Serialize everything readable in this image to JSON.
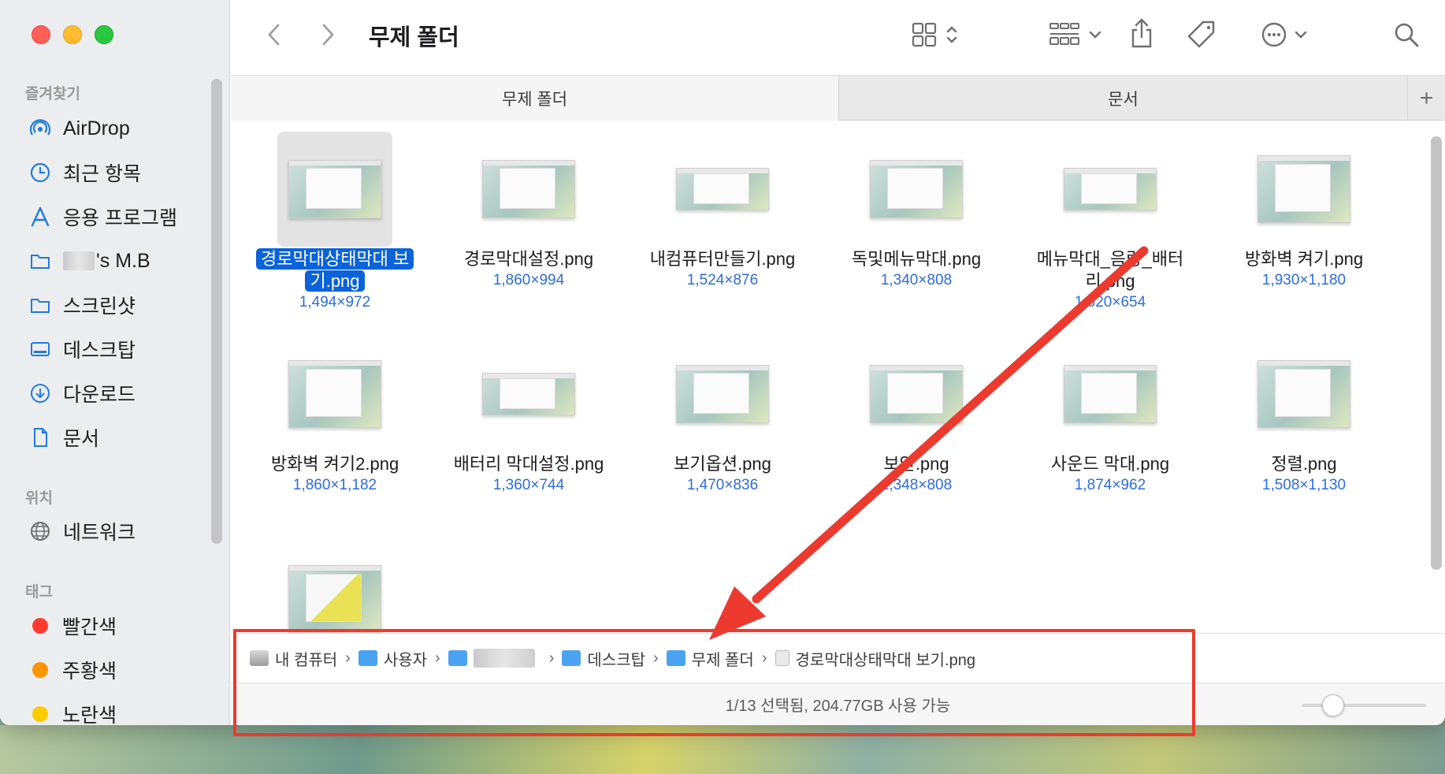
{
  "window": {
    "title": "무제 폴더"
  },
  "sidebar": {
    "favorites_header": "즐겨찾기",
    "favorites": [
      {
        "label": "AirDrop",
        "icon": "airdrop-icon"
      },
      {
        "label": "최근 항목",
        "icon": "clock-icon"
      },
      {
        "label": "응용 프로그램",
        "icon": "applications-icon"
      },
      {
        "label": "'s M.B",
        "icon": "folder-icon"
      },
      {
        "label": "스크린샷",
        "icon": "folder-icon"
      },
      {
        "label": "데스크탑",
        "icon": "desktop-icon"
      },
      {
        "label": "다운로드",
        "icon": "download-icon"
      },
      {
        "label": "문서",
        "icon": "document-icon"
      }
    ],
    "locations_header": "위치",
    "locations": [
      {
        "label": "네트워크",
        "icon": "globe-icon"
      }
    ],
    "tags_header": "태그",
    "tags": [
      {
        "label": "빨간색",
        "color": "#ff3b30"
      },
      {
        "label": "주황색",
        "color": "#ff9500"
      },
      {
        "label": "노란색",
        "color": "#ffcc00"
      }
    ]
  },
  "tabs": [
    {
      "label": "무제 폴더",
      "active": true
    },
    {
      "label": "문서",
      "active": false
    }
  ],
  "files": [
    {
      "name": "경로막대상태막대 보기.png",
      "dims": "1,494×972",
      "selected": true
    },
    {
      "name": "경로막대설정.png",
      "dims": "1,860×994"
    },
    {
      "name": "내컴퓨터만들기.png",
      "dims": "1,524×876"
    },
    {
      "name": "독및메뉴막대.png",
      "dims": "1,340×808"
    },
    {
      "name": "메뉴막대_음량_배터리.png",
      "dims": "1,620×654"
    },
    {
      "name": "방화벽 켜기.png",
      "dims": "1,930×1,180"
    },
    {
      "name": "방화벽 켜기2.png",
      "dims": "1,860×1,182"
    },
    {
      "name": "배터리 막대설정.png",
      "dims": "1,360×744"
    },
    {
      "name": "보기옵션.png",
      "dims": "1,470×836"
    },
    {
      "name": "보안.png",
      "dims": "1,348×808"
    },
    {
      "name": "사운드 막대.png",
      "dims": "1,874×962"
    },
    {
      "name": "정렬.png",
      "dims": "1,508×1,130"
    },
    {
      "name": "",
      "dims": ""
    }
  ],
  "pathbar": {
    "crumbs": [
      {
        "label": "내 컴퓨터"
      },
      {
        "label": "사용자"
      },
      {
        "label": ""
      },
      {
        "label": "데스크탑"
      },
      {
        "label": "무제 폴더"
      },
      {
        "label": "경로막대상태막대 보기.png"
      }
    ]
  },
  "status": {
    "text": "1/13 선택됨, 204.77GB 사용 가능",
    "icon_size_level": 0.2
  },
  "colors": {
    "accent": "#0a63d9",
    "annotation": "#ec3a2e"
  }
}
